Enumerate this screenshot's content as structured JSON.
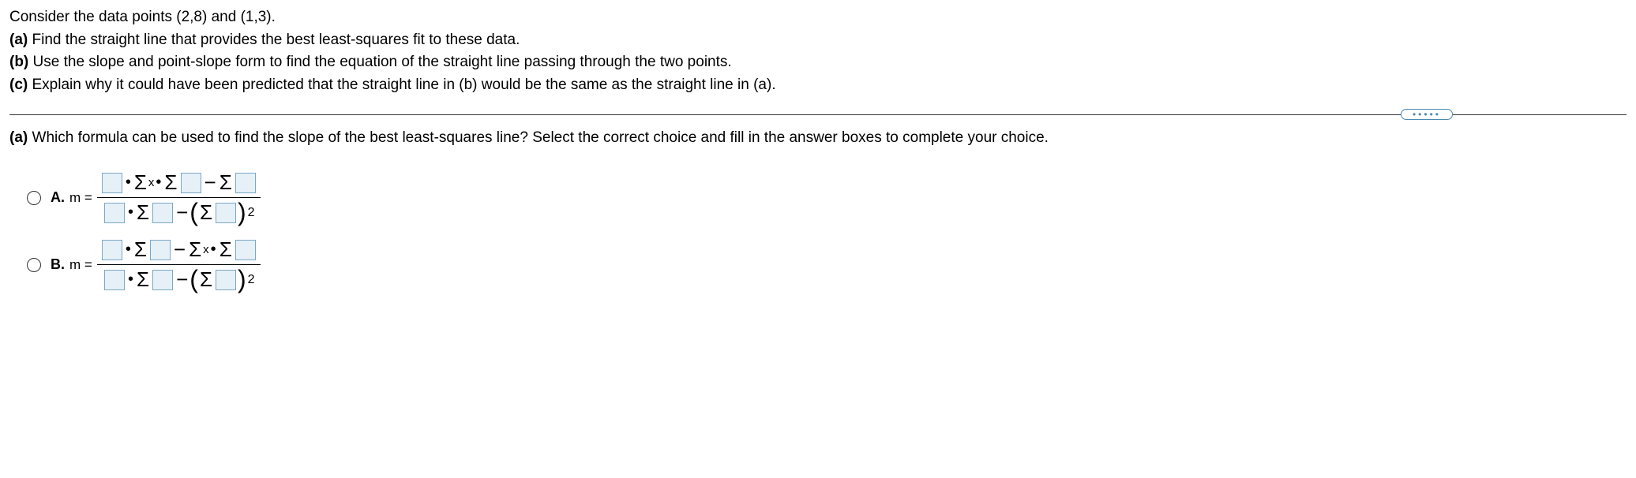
{
  "problem": {
    "intro": "Consider the data points (2,8) and (1,3).",
    "part_a_label": "(a)",
    "part_a_text": " Find the straight line that provides the best least-squares fit to these data.",
    "part_b_label": "(b)",
    "part_b_text": " Use the slope and point-slope form to find the equation of the straight line passing through the two points.",
    "part_c_label": "(c)",
    "part_c_text": " Explain why it could have been predicted that the straight line in (b) would be the same as the straight line in (a)."
  },
  "divider_dots": "•••••",
  "question": {
    "part_label": "(a)",
    "text": " Which formula can be used to find the slope of the best least-squares line? Select the correct choice and fill in the answer boxes to complete your choice."
  },
  "choices": {
    "a": {
      "label": "A.",
      "m": "m ="
    },
    "b": {
      "label": "B.",
      "m": "m ="
    }
  },
  "symbols": {
    "sigma": "Σ",
    "x": "x",
    "minus": "−",
    "dot": "•",
    "lparen": "(",
    "rparen": ")",
    "two": "2"
  }
}
